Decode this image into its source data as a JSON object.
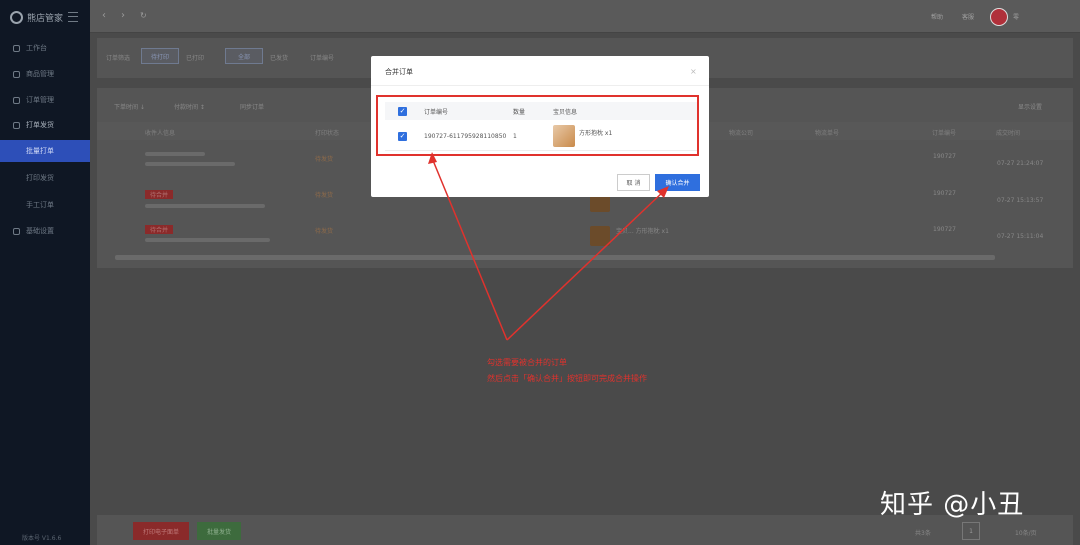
{
  "sidebar": {
    "logo": "熊店管家",
    "items": [
      {
        "label": "工作台"
      },
      {
        "label": "商品管理"
      },
      {
        "label": "订单管理"
      },
      {
        "label": "打单发货"
      }
    ],
    "subitems": [
      {
        "label": "批量打单"
      },
      {
        "label": "打印发货"
      },
      {
        "label": "手工订单"
      }
    ],
    "extra": {
      "label": "基础设置"
    },
    "footer": "版本号 V1.6.6"
  },
  "topbar": {
    "links": [
      "帮助",
      "客服"
    ],
    "user": "零"
  },
  "filters": {
    "label": "订单筛选",
    "chips": [
      "待打印",
      "已打印"
    ],
    "chip2": [
      "全部",
      "已发货",
      "订单编号"
    ]
  },
  "toolbar": {
    "items": [
      "下单时间 ↓",
      "付款时间 ↕",
      "同步订单"
    ],
    "settings": "显示设置"
  },
  "table": {
    "headers": [
      "收件人信息",
      "打印状态",
      "物流公司",
      "物流单号",
      "订单编号",
      "成交时间"
    ],
    "rows": [
      {
        "status": "待发货",
        "order": "190727",
        "time": "07-27 21:24:07",
        "tag": ""
      },
      {
        "status": "待发货",
        "order": "190727",
        "time": "07-27 15:13:57",
        "tag": "待合并"
      },
      {
        "status": "待发货",
        "order": "190727",
        "time": "07-27 15:11:04",
        "tag": "待合并"
      }
    ],
    "product_label": "宝贝... 方形抱枕 x1"
  },
  "modal": {
    "title": "合并订单",
    "close": "×",
    "headers": [
      "订单编号",
      "数量",
      "宝贝信息"
    ],
    "row": {
      "order_no": "190727-611795928110850",
      "qty": "1",
      "item": "方形抱枕 x1"
    },
    "cancel": "取 消",
    "confirm": "确认合并"
  },
  "annotation": {
    "line1": "勾选需要被合并的订单",
    "line2": "然后点击「确认合并」按钮即可完成合并操作"
  },
  "footer": {
    "btn_print": "打印电子面单",
    "btn_ship": "批量发货",
    "total": "共3条",
    "page": "1",
    "per_page": "10条/页"
  },
  "watermark": "知乎 @小丑",
  "colors": {
    "accent": "#2f6fde",
    "annotation_red": "#e0322d",
    "sidebar_bg": "#0f1724"
  }
}
